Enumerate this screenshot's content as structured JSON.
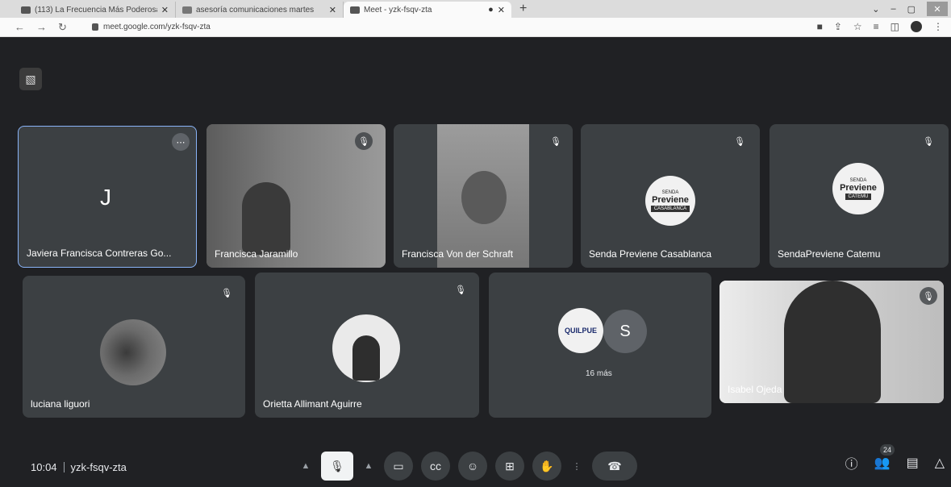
{
  "browser": {
    "tabs": [
      {
        "title": "(113) La Frecuencia Más Poderosa"
      },
      {
        "title": "asesoría comunicaciones martes"
      },
      {
        "title": "Meet - yzk-fsqv-zta"
      }
    ],
    "url": "meet.google.com/yzk-fsqv-zta"
  },
  "participants": {
    "p1": {
      "name": "Javiera Francisca Contreras Go...",
      "initial": "J"
    },
    "p2": {
      "name": "Francisca Jaramillo"
    },
    "p3": {
      "name": "Francisca Von der Schraft"
    },
    "p4": {
      "name": "Senda Previene Casablanca",
      "logo": {
        "l1": "SENDA",
        "l2": "Previene",
        "l3": "CASABLANCA"
      }
    },
    "p5": {
      "name": "SendaPreviene Catemu",
      "logo": {
        "l1": "SENDA",
        "l2": "Previene",
        "l3": "CATEMU"
      }
    },
    "p6": {
      "name": "luciana liguori"
    },
    "p7": {
      "name": "Orietta Allimant Aguirre"
    },
    "p8": {
      "more": "16 más",
      "initial": "S",
      "logo": "QUILPUE"
    },
    "p9": {
      "name": "Isabel Ojeda"
    }
  },
  "footer": {
    "time": "10:04",
    "code": "yzk-fsqv-zta",
    "people_count": "24"
  }
}
